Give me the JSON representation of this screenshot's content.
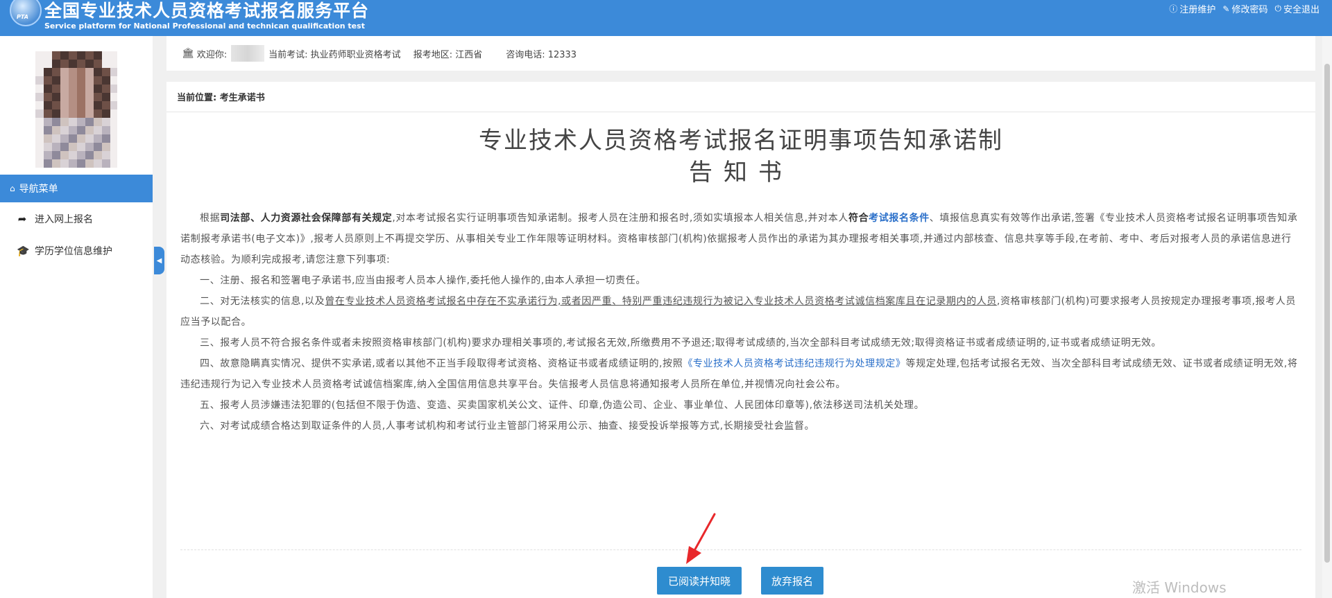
{
  "header": {
    "logo_text": "PTA",
    "title": "全国专业技术人员资格考试报名服务平台",
    "subtitle": "Service platform for National Professional and technican qualification test",
    "links": [
      {
        "icon": "info-icon",
        "label": "注册维护"
      },
      {
        "icon": "edit-icon",
        "label": "修改密码"
      },
      {
        "icon": "power-icon",
        "label": "安全退出"
      }
    ]
  },
  "sidebar": {
    "nav_header": "导航菜单",
    "items": [
      {
        "icon": "share-icon",
        "label": "进入网上报名"
      },
      {
        "icon": "graduation-cap-icon",
        "label": "学历学位信息维护"
      }
    ]
  },
  "infobar": {
    "welcome": "欢迎你:",
    "exam": "当前考试: 执业药师职业资格考试",
    "region": "报考地区: 江西省",
    "phone": "咨询电话: 12333"
  },
  "breadcrumb": "当前位置: 考生承诺书",
  "document": {
    "title_line1": "专业技术人员资格考试报名证明事项告知承诺制",
    "title_line2": "告知书",
    "intro": {
      "p1": "根据",
      "p2": "司法部、人力资源社会保障部有关规定",
      "p3": ",对本考试报名实行证明事项告知承诺制。报考人员在注册和报名时,须如实填报本人相关信息,并对本人",
      "p4": "符合",
      "p5": "考试报名条件",
      "p6": "、填报信息真实有效等作出承诺,签署《专业技术人员资格考试报名证明事项告知承诺制报考承诺书(电子文本)》,报考人员原则上不再提交学历、从事相关专业工作年限等证明材料。资格审核部门(机构)依据报考人员作出的承诺为其办理报考相关事项,并通过内部核查、信息共享等手段,在考前、考中、考后对报考人员的承诺信息进行动态核验。为顺利完成报考,请您注意下列事项:"
    },
    "item1": "一、注册、报名和签署电子承诺书,应当由报考人员本人操作,委托他人操作的,由本人承担一切责任。",
    "item2": {
      "a": "二、对无法核实的信息,以及",
      "b": "曾在专业技术人员资格考试报名中存在不实承诺行为,或者因严重、特别严重违纪违规行为被记入专业技术人员资格考试诚信档案库且在记录期内的人员",
      "c": ",资格审核部门(机构)可要求报考人员按规定办理报考事项,报考人员应当予以配合。"
    },
    "item3": "三、报考人员不符合报名条件或者未按照资格审核部门(机构)要求办理相关事项的,考试报名无效,所缴费用不予退还;取得考试成绩的,当次全部科目考试成绩无效;取得资格证书或者成绩证明的,证书或者成绩证明无效。",
    "item4": {
      "a": "四、故意隐瞒真实情况、提供不实承诺,或者以其他不正当手段取得考试资格、资格证书或者成绩证明的,按照",
      "b": "《专业技术人员资格考试违纪违规行为处理规定》",
      "c": "等规定处理,包括考试报名无效、当次全部科目考试成绩无效、证书或者成绩证明无效,将违纪违规行为记入专业技术人员资格考试诚信档案库,纳入全国信用信息共享平台。失信报考人员信息将通知报考人员所在单位,并视情况向社会公布。"
    },
    "item5": "五、报考人员涉嫌违法犯罪的(包括但不限于伪造、变造、买卖国家机关公文、证件、印章,伪造公司、企业、事业单位、人民团体印章等),依法移送司法机关处理。",
    "item6": "六、对考试成绩合格达到取证条件的人员,人事考试机构和考试行业主管部门将采用公示、抽查、接受投诉举报等方式,长期接受社会监督。"
  },
  "buttons": {
    "read": "已阅读并知晓",
    "quit": "放弃报名"
  },
  "watermark": "激活 Windows",
  "colors": {
    "primary": "#3c8ad9",
    "button": "#2e8ccf",
    "link": "#2a6fc9",
    "arrow": "#e8282b"
  }
}
